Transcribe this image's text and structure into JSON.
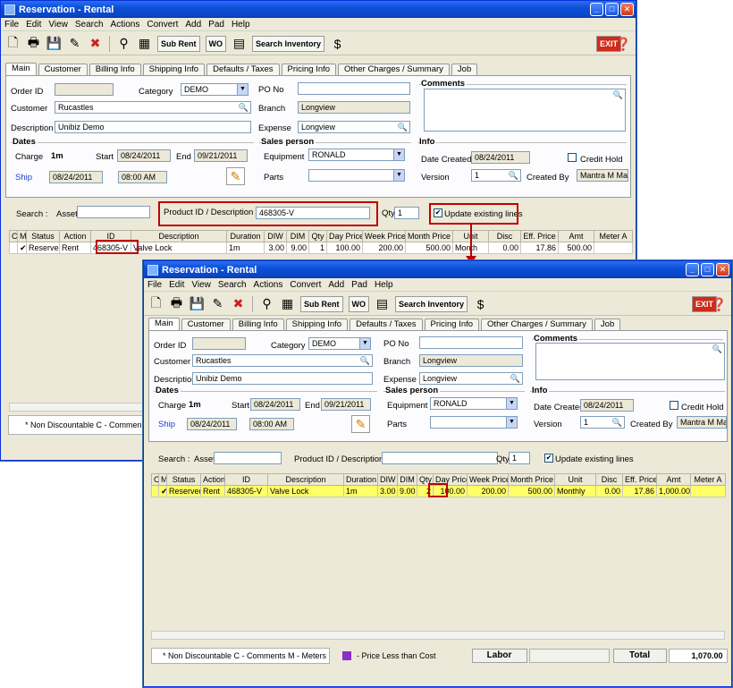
{
  "window": {
    "title": "Reservation - Rental",
    "menu": [
      "File",
      "Edit",
      "View",
      "Search",
      "Actions",
      "Convert",
      "Add",
      "Pad",
      "Help"
    ],
    "toolbar": {
      "sub_rent": "Sub Rent",
      "wo": "WO",
      "search_inventory": "Search Inventory",
      "exit": "EXIT"
    },
    "tabs": [
      "Main",
      "Customer",
      "Billing Info",
      "Shipping Info",
      "Defaults / Taxes",
      "Pricing Info",
      "Other Charges / Summary",
      "Job"
    ]
  },
  "main": {
    "order_id_label": "Order ID",
    "order_id": "",
    "category_label": "Category",
    "category": "DEMO",
    "customer_label": "Customer",
    "customer": "Rucastles",
    "description_label": "Description",
    "description": "Unibiz Demo",
    "po_label": "PO No",
    "po": "",
    "branch_label": "Branch",
    "branch": "Longview",
    "expense_label": "Expense",
    "expense": "Longview",
    "comments_label": "Comments"
  },
  "dates": {
    "title": "Dates",
    "charge_label": "Charge",
    "charge": "1m",
    "start_label": "Start",
    "start": "08/24/2011",
    "end_label": "End",
    "end": "09/21/2011",
    "ship_label": "Ship",
    "ship_date": "08/24/2011",
    "ship_time": "08:00 AM"
  },
  "sales": {
    "title": "Sales person",
    "equipment_label": "Equipment",
    "equipment": "RONALD",
    "parts_label": "Parts",
    "parts": ""
  },
  "info": {
    "title": "Info",
    "date_created_label": "Date Created",
    "date_created": "08/24/2011",
    "credit_hold": "Credit Hold",
    "version_label": "Version",
    "version": "1",
    "created_by_label": "Created By",
    "created_by": "Mantra M Mantra"
  },
  "search": {
    "label": "Search :",
    "asset_label": "Asset#",
    "product_label": "Product ID / Description",
    "product_value_top": "468305-V",
    "product_value_bottom": "",
    "qty_label": "Qty",
    "qty": "1",
    "update_label": "Update existing lines"
  },
  "grid": {
    "headers": [
      "C",
      "M",
      "Status",
      "Action",
      "ID",
      "Description",
      "Duration",
      "DIW",
      "DIM",
      "Qty",
      "Day Price",
      "Week Price",
      "Month Price",
      "Unit",
      "Disc",
      "Eff. Price",
      "Amt",
      "Meter A"
    ],
    "row_top": [
      "",
      "✔",
      "Reserved",
      "Rent",
      "468305-V",
      "Valve Lock",
      "1m",
      "3.00",
      "9.00",
      "1",
      "100.00",
      "200.00",
      "500.00",
      "Month",
      "0.00",
      "17.86",
      "500.00",
      ""
    ],
    "row_bottom": [
      "",
      "✔",
      "Reserved",
      "Rent",
      "468305-V",
      "Valve Lock",
      "1m",
      "3.00",
      "9.00",
      "2",
      "100.00",
      "200.00",
      "500.00",
      "Monthly",
      "0.00",
      "17.86",
      "1,000.00",
      ""
    ]
  },
  "status": {
    "legend": "* Non Discountable  C - Comments  M - Meters",
    "legend_short": "* Non Discountable  C - Commen",
    "price_less": "- Price Less than Cost",
    "labor": "Labor",
    "total": "Total",
    "total_value": "1,070.00",
    "swatch_color": "#8b2fc9"
  },
  "colors": {
    "highlight": "#ffff66",
    "annotation": "#c00000"
  }
}
